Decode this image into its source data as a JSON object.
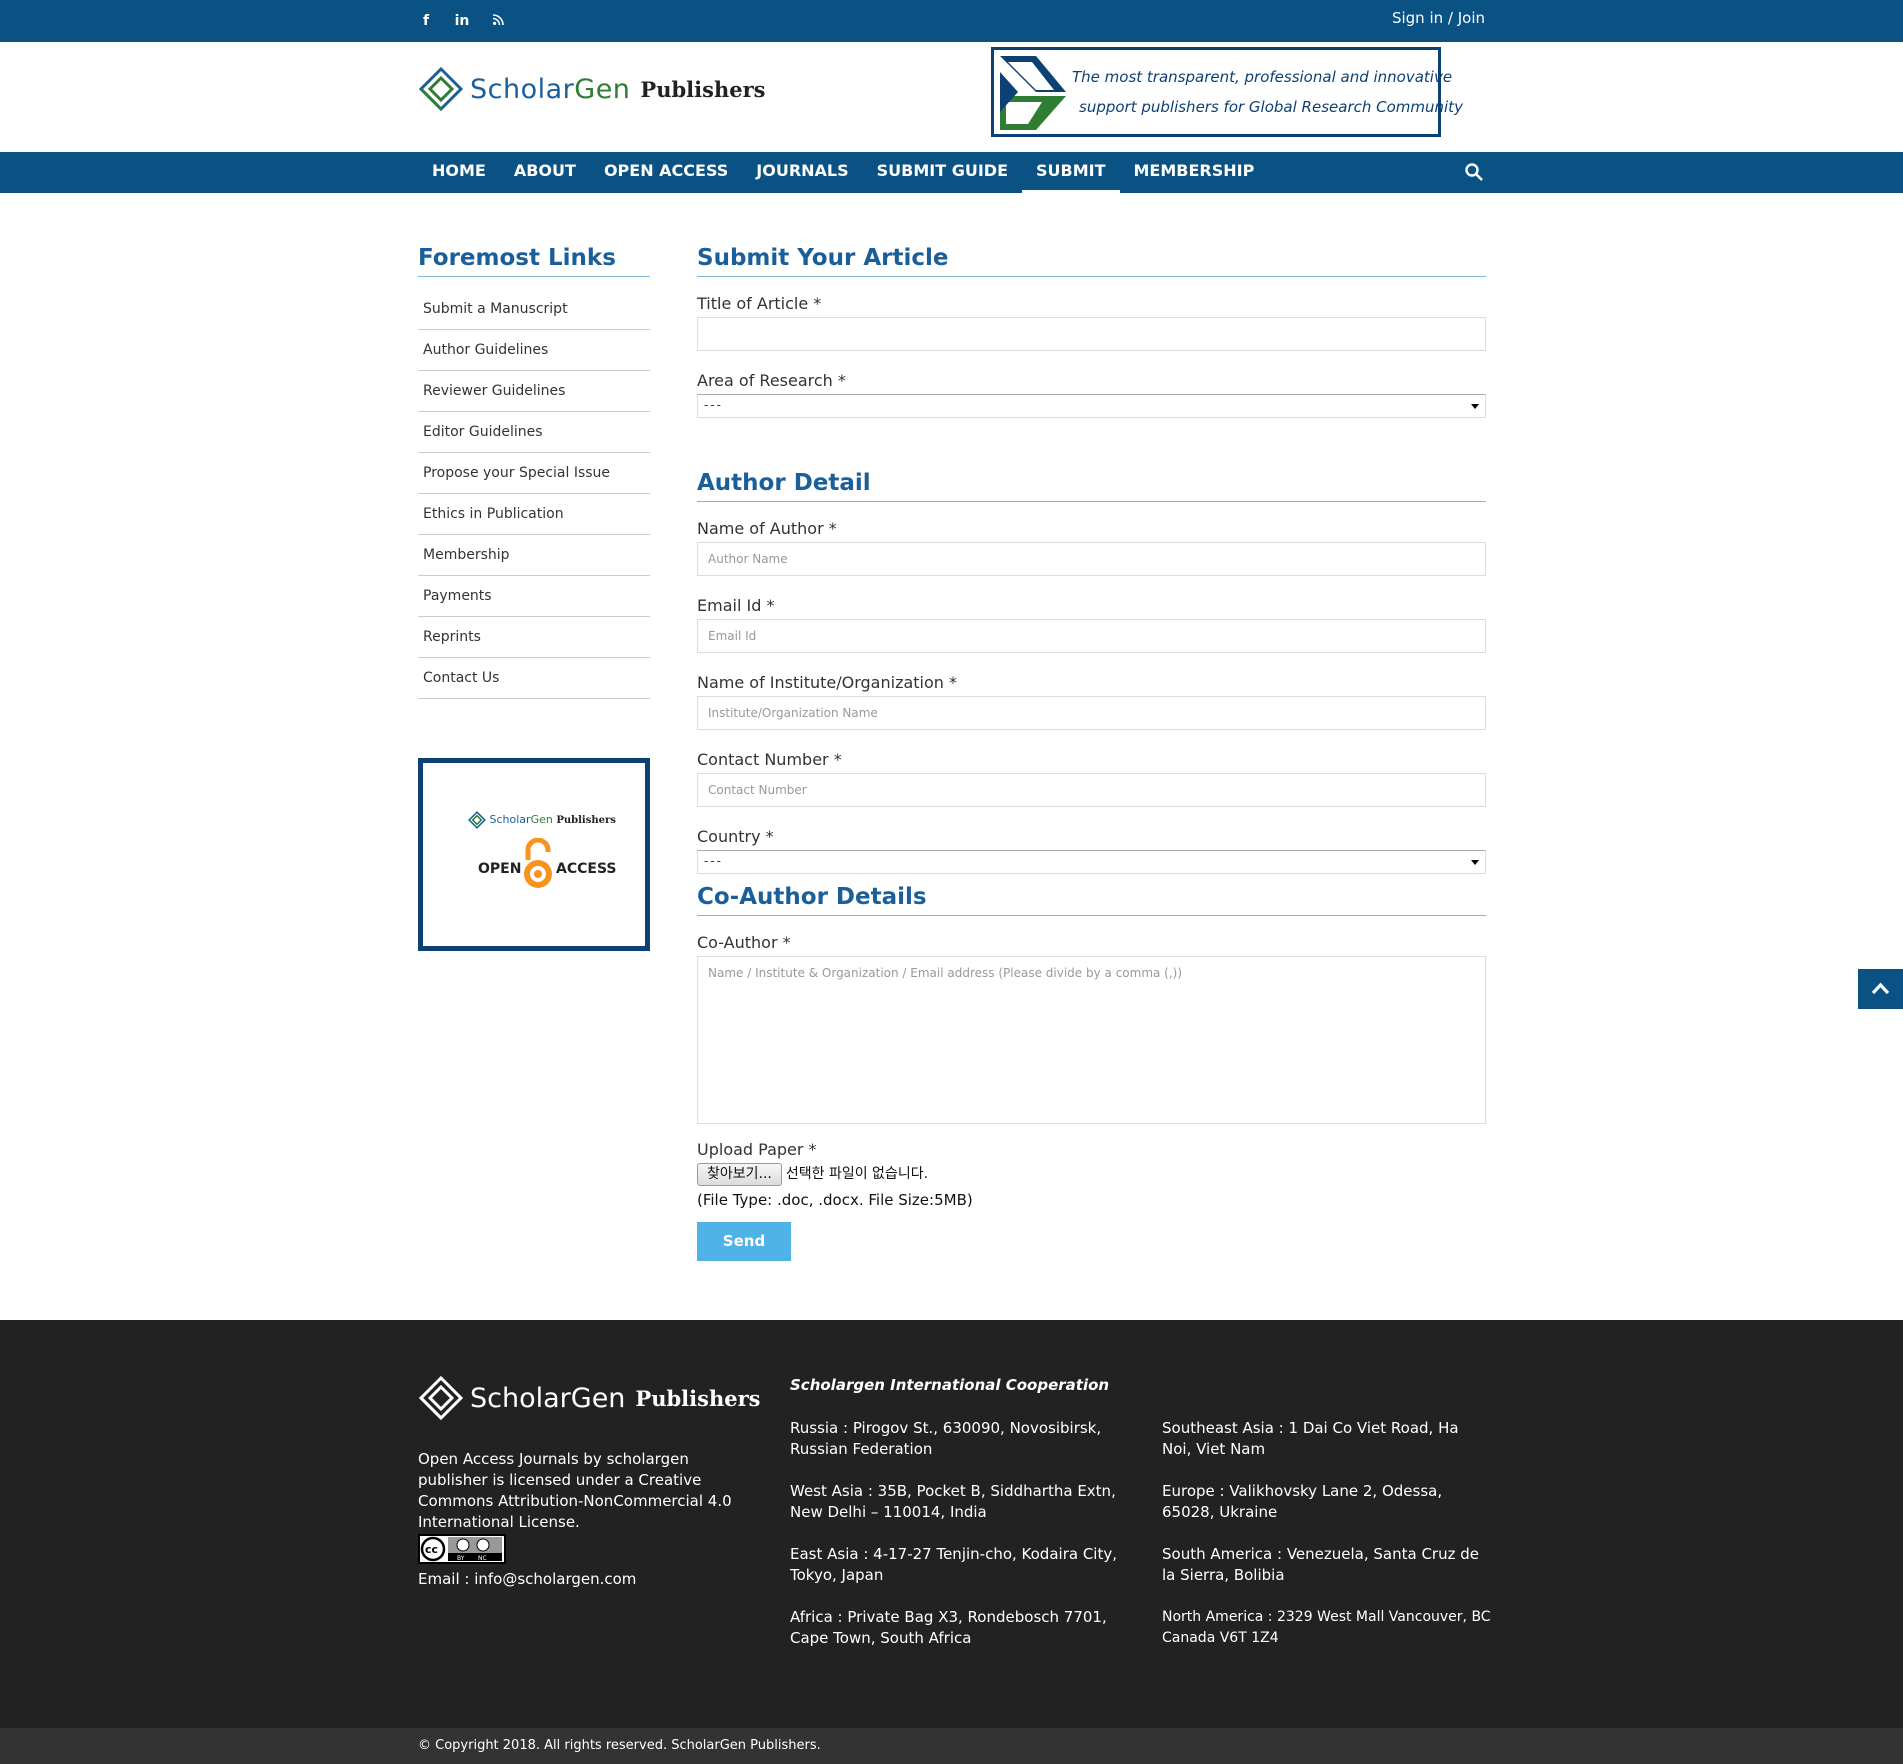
{
  "topbar": {
    "social": [
      "f",
      "in",
      "rss"
    ],
    "signin": "Sign in / Join"
  },
  "header": {
    "logo_scholar": "Scholar",
    "logo_gen": "Gen",
    "logo_publishers": "Publishers",
    "banner_line1": "The most transparent, professional and innovative",
    "banner_line2": "support publishers for Global Research Community"
  },
  "nav": {
    "items": [
      "HOME",
      "ABOUT",
      "OPEN ACCESS",
      "JOURNALS",
      "SUBMIT GUIDE",
      "SUBMIT",
      "MEMBERSHIP"
    ],
    "active": "SUBMIT"
  },
  "sidebar": {
    "title": "Foremost Links",
    "links": [
      "Submit a Manuscript",
      "Author Guidelines",
      "Reviewer Guidelines",
      "Editor Guidelines",
      "Propose your Special Issue",
      "Ethics in Publication",
      "Membership",
      "Payments",
      "Reprints",
      "Contact Us"
    ],
    "oa_open": "OPEN",
    "oa_access": "ACCESS"
  },
  "form": {
    "submit_title": "Submit Your Article",
    "title_label": "Title of Article *",
    "title_value": "",
    "area_label": "Area of Research *",
    "area_value": "---",
    "author_title": "Author Detail",
    "name_label": "Name of Author *",
    "name_placeholder": "Author Name",
    "email_label": "Email Id *",
    "email_placeholder": "Email Id",
    "inst_label": "Name of Institute/Organization *",
    "inst_placeholder": "Institute/Organization Name",
    "contact_label": "Contact Number *",
    "contact_placeholder": "Contact Number",
    "country_label": "Country *",
    "country_value": "---",
    "coauthor_title": "Co-Author Details",
    "coauthor_label": "Co-Author *",
    "coauthor_placeholder": "Name / Institute & Organization / Email address (Please divide by a comma (,))",
    "upload_label": "Upload Paper *",
    "file_button": "찾아보기...",
    "file_status": "선택한 파일이 없습니다.",
    "file_note": "(File Type: .doc, .docx. File Size:5MB)",
    "send": "Send"
  },
  "footer": {
    "license": "Open Access Journals by scholargen publisher is licensed under a Creative Commons Attribution-NonCommercial 4.0 International License.",
    "email": "Email : info@scholargen.com",
    "coop_title": "Scholargen International Cooperation",
    "addresses": [
      "Russia : Pirogov St., 630090, Novosibirsk, Russian Federation",
      "Southeast Asia : 1 Dai Co Viet Road, Ha Noi, Viet Nam",
      "West Asia : 35B, Pocket B, Siddhartha Extn, New Delhi – 110014, India",
      "Europe : Valikhovsky Lane 2, Odessa, 65028, Ukraine",
      "East Asia : 4-17-27 Tenjin-cho, Kodaira City, Tokyo, Japan",
      "South America : Venezuela, Santa Cruz de la Sierra, Bolibia",
      "Africa :  Private Bag X3, Rondebosch 7701, Cape Town, South Africa",
      "North America : 2329 West Mall Vancouver, BC Canada V6T 1Z4"
    ],
    "cc_by": "BY",
    "cc_nc": "NC",
    "copyright": "© Copyright 2018. All rights reserved. ScholarGen Publishers."
  },
  "colors": {
    "brand_blue": "#0a5184",
    "heading_blue": "#1b5f9a",
    "send_button": "#4fb3e8",
    "footer_bg": "#222222"
  }
}
